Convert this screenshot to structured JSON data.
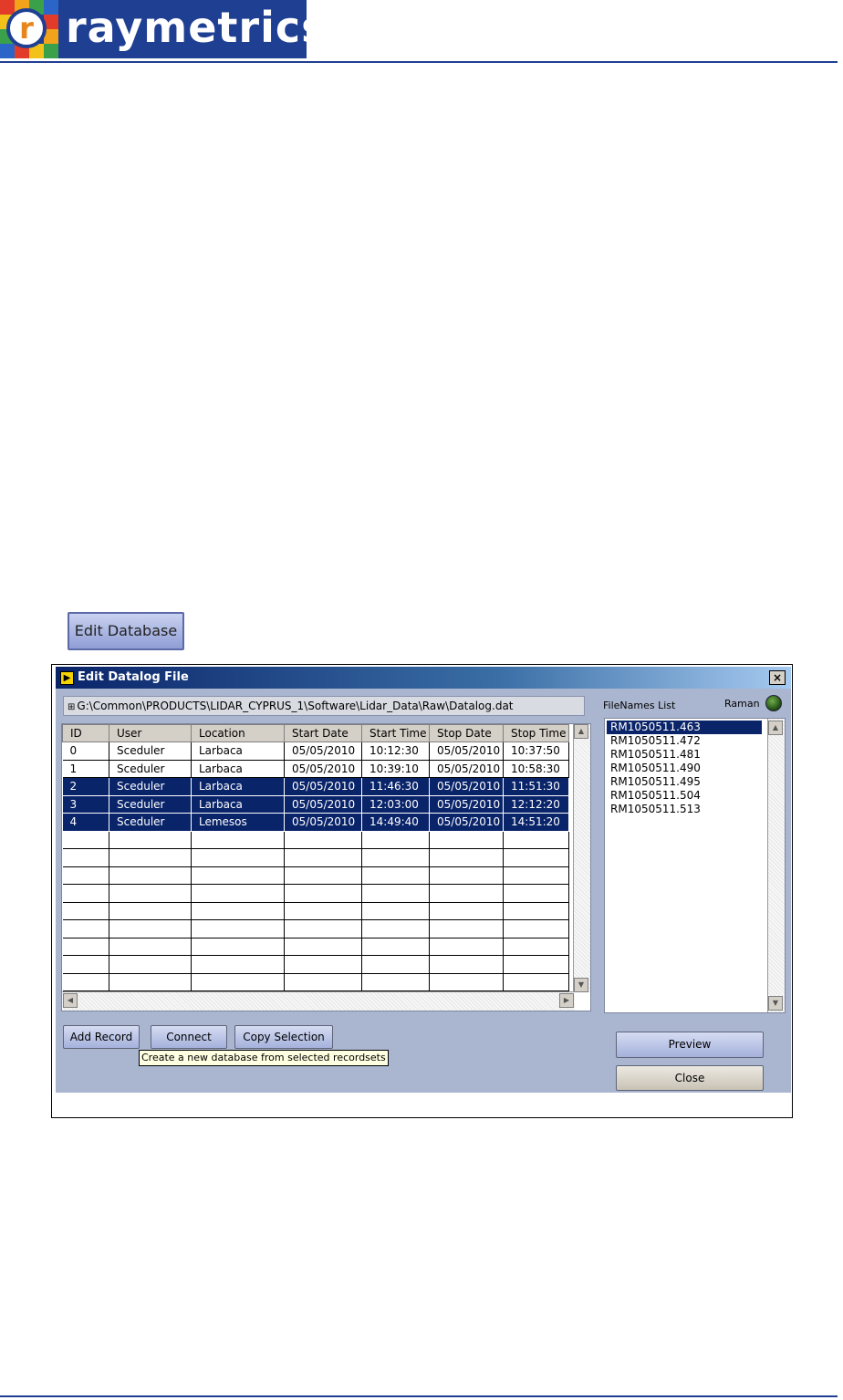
{
  "header": {
    "brand": "raymetrics",
    "logo_letter": "r"
  },
  "edit_db_button": {
    "label": "Edit Database"
  },
  "dialog": {
    "title": "Edit Datalog File",
    "close_glyph": "×",
    "path": "G:\\Common\\PRODUCTS\\LIDAR_CYPRUS_1\\Software\\Lidar_Data\\Raw\\Datalog.dat",
    "filenames_label": "FileNames List",
    "raman_label": "Raman",
    "table": {
      "columns": [
        "ID",
        "User",
        "Location",
        "Start Date",
        "Start Time",
        "Stop Date",
        "Stop Time"
      ],
      "rows": [
        [
          "0",
          "Sceduler",
          "Larbaca",
          "05/05/2010",
          "10:12:30",
          "05/05/2010",
          "10:37:50"
        ],
        [
          "1",
          "Sceduler",
          "Larbaca",
          "05/05/2010",
          "10:39:10",
          "05/05/2010",
          "10:58:30"
        ],
        [
          "2",
          "Sceduler",
          "Larbaca",
          "05/05/2010",
          "11:46:30",
          "05/05/2010",
          "11:51:30"
        ],
        [
          "3",
          "Sceduler",
          "Larbaca",
          "05/05/2010",
          "12:03:00",
          "05/05/2010",
          "12:12:20"
        ],
        [
          "4",
          "Sceduler",
          "Lemesos",
          "05/05/2010",
          "14:49:40",
          "05/05/2010",
          "14:51:20"
        ]
      ],
      "selected_rows": [
        2,
        3,
        4
      ]
    },
    "files": [
      "RM1050511.463",
      "RM1050511.472",
      "RM1050511.481",
      "RM1050511.490",
      "RM1050511.495",
      "RM1050511.504",
      "RM1050511.513"
    ],
    "selected_file": 0,
    "buttons": {
      "add_record": "Add Record",
      "connect": "Connect",
      "copy_selection": "Copy Selection",
      "preview": "Preview",
      "close": "Close"
    },
    "tooltip": "Create a new database from selected recordsets"
  },
  "colors": {
    "brand_blue": "#1f3f93",
    "selection": "#0a246a",
    "dialog_bg": "#aab6cf",
    "led": "#2f6a1e"
  }
}
